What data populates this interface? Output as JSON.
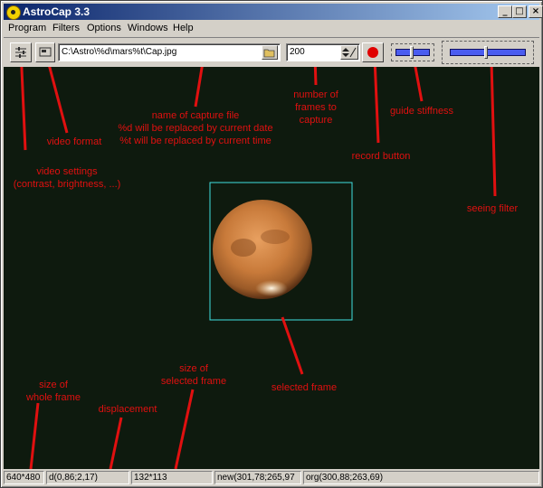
{
  "window": {
    "title": "AstroCap 3.3"
  },
  "titlebar": {
    "minimize": "_",
    "maximize": "□",
    "close": "×"
  },
  "menu": [
    "Program",
    "Filters",
    "Options",
    "Windows",
    "Help"
  ],
  "toolbar": {
    "filename_value": "C:\\Astro\\%d\\mars%t\\Cap.jpg",
    "frames_value": "200"
  },
  "annotations": {
    "video_settings": [
      "video settings",
      "(contrast, brightness, ...)"
    ],
    "video_format": "video format",
    "capture_file": [
      "name of capture file",
      "%d will be replaced by current date",
      "%t will be replaced by current time"
    ],
    "frames": [
      "number of",
      "frames to",
      "capture"
    ],
    "guide_stiffness": "guide stiffness",
    "record_button": "record button",
    "seeing_filter": "seeing filter",
    "size_whole": [
      "size of",
      "whole frame"
    ],
    "displacement": "displacement",
    "size_selected": [
      "size of",
      "selected frame"
    ],
    "selected_frame": "selected frame"
  },
  "colors": {
    "annotation": "#e01010",
    "selection": "#40e0e0",
    "record": "#e00000",
    "background": "#0e1a0e"
  },
  "status": {
    "frame_size": "640*480",
    "displacement": "d(0,86;2,17)",
    "selected_size": "132*113",
    "new": "new(301,78;265,97",
    "org": "org(300,88;263,69)"
  }
}
